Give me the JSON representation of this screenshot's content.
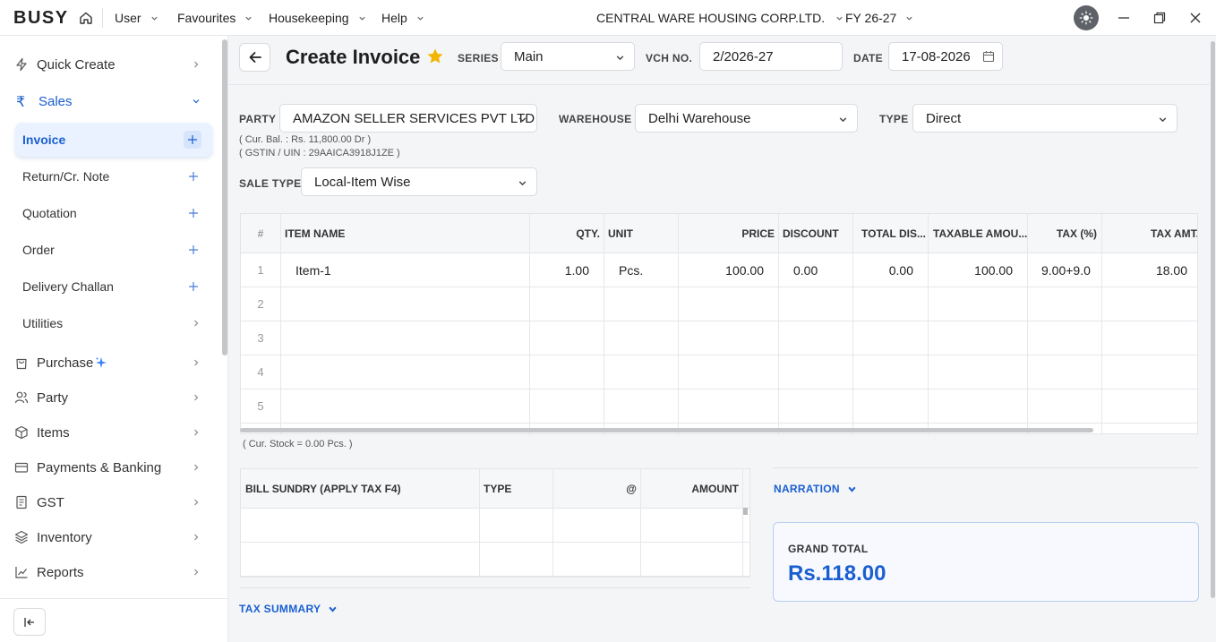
{
  "app": {
    "logo": "BUSY"
  },
  "topbar": {
    "menus": [
      "User",
      "Favourites",
      "Housekeeping",
      "Help"
    ],
    "company": "CENTRAL WARE HOUSING CORP.LTD.",
    "fy": "FY 26-27"
  },
  "sidebar": {
    "quick_create": "Quick Create",
    "sales": "Sales",
    "sales_items": [
      "Invoice",
      "Return/Cr. Note",
      "Quotation",
      "Order",
      "Delivery Challan",
      "Utilities"
    ],
    "sections": [
      "Purchase",
      "Party",
      "Items",
      "Payments & Banking",
      "GST",
      "Inventory",
      "Reports"
    ]
  },
  "header": {
    "title": "Create Invoice",
    "series_label": "SERIES",
    "series": "Main",
    "vch_label": "VCH NO.",
    "vch_no": "2/2026-27",
    "date_label": "DATE",
    "date": "17-08-2026"
  },
  "form": {
    "party_label": "PARTY",
    "party": "AMAZON SELLER SERVICES PVT LTD",
    "cur_bal": "( Cur. Bal. : Rs. 11,800.00 Dr )",
    "gstin": "( GSTIN / UIN : 29AAICA3918J1ZE )",
    "warehouse_label": "WAREHOUSE",
    "warehouse": "Delhi Warehouse",
    "type_label": "TYPE",
    "type": "Direct",
    "sale_type_label": "SALE TYPE",
    "sale_type": "Local-Item Wise"
  },
  "items_table": {
    "headers": [
      "#",
      "ITEM NAME",
      "QTY.",
      "UNIT",
      "PRICE",
      "DISCOUNT",
      "TOTAL DIS...",
      "TAXABLE AMOU...",
      "TAX (%)",
      "TAX AMT."
    ],
    "rows": [
      [
        "1",
        "Item-1",
        "1.00",
        "Pcs.",
        "100.00",
        "0.00",
        "0.00",
        "100.00",
        "9.00+9.0",
        "18.00"
      ],
      [
        "2",
        "",
        "",
        "",
        "",
        "",
        "",
        "",
        "",
        ""
      ],
      [
        "3",
        "",
        "",
        "",
        "",
        "",
        "",
        "",
        "",
        ""
      ],
      [
        "4",
        "",
        "",
        "",
        "",
        "",
        "",
        "",
        "",
        ""
      ],
      [
        "5",
        "",
        "",
        "",
        "",
        "",
        "",
        "",
        "",
        ""
      ]
    ],
    "cur_stock": "( Cur. Stock = 0.00  Pcs. )"
  },
  "bill_sundry": {
    "headers": [
      "BILL SUNDRY (APPLY TAX F4)",
      "TYPE",
      "@",
      "AMOUNT"
    ]
  },
  "narration": "NARRATION",
  "tax_summary": "TAX SUMMARY",
  "grand_total": {
    "label": "GRAND TOTAL",
    "value": "Rs.118.00"
  },
  "colors": {
    "accent": "#1a5fd0",
    "star": "#f2b600"
  }
}
